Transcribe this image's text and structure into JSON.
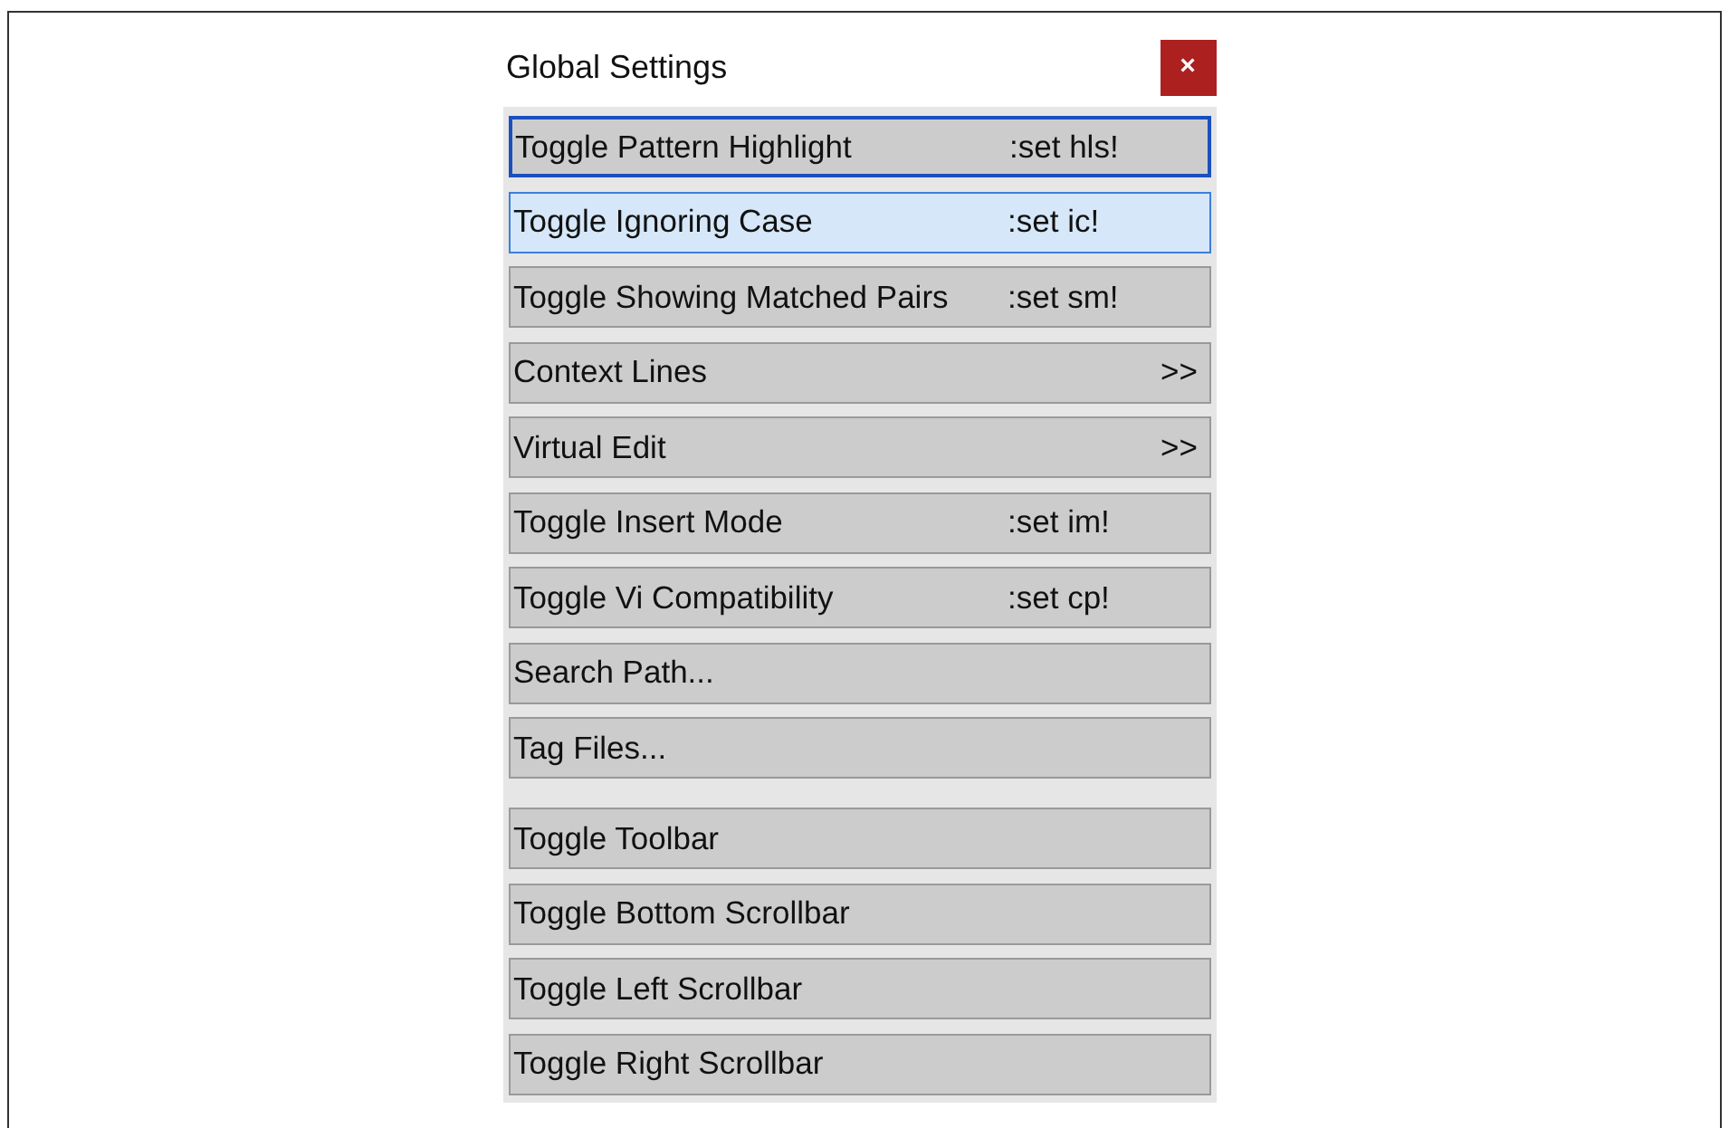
{
  "window": {
    "title": "Global Settings",
    "close": "×"
  },
  "groups": [
    {
      "items": [
        {
          "label": "Toggle Pattern Highlight",
          "shortcut": ":set hls!",
          "focused": true,
          "highlighted": false
        },
        {
          "label": "Toggle Ignoring Case",
          "shortcut": ":set ic!",
          "focused": false,
          "highlighted": true
        },
        {
          "label": "Toggle Showing Matched Pairs",
          "shortcut": ":set sm!",
          "focused": false,
          "highlighted": false
        },
        {
          "label": "Context Lines",
          "submenu": ">>",
          "focused": false,
          "highlighted": false
        },
        {
          "label": "Virtual Edit",
          "submenu": ">>",
          "focused": false,
          "highlighted": false
        },
        {
          "label": "Toggle Insert Mode",
          "shortcut": ":set im!",
          "focused": false,
          "highlighted": false
        },
        {
          "label": "Toggle Vi Compatibility",
          "shortcut": ":set cp!",
          "focused": false,
          "highlighted": false
        },
        {
          "label": "Search Path...",
          "focused": false,
          "highlighted": false
        },
        {
          "label": "Tag Files...",
          "focused": false,
          "highlighted": false
        }
      ]
    },
    {
      "items": [
        {
          "label": "Toggle Toolbar",
          "focused": false,
          "highlighted": false
        },
        {
          "label": "Toggle Bottom Scrollbar",
          "focused": false,
          "highlighted": false
        },
        {
          "label": "Toggle Left Scrollbar",
          "focused": false,
          "highlighted": false
        },
        {
          "label": "Toggle Right Scrollbar",
          "focused": false,
          "highlighted": false
        }
      ]
    }
  ]
}
